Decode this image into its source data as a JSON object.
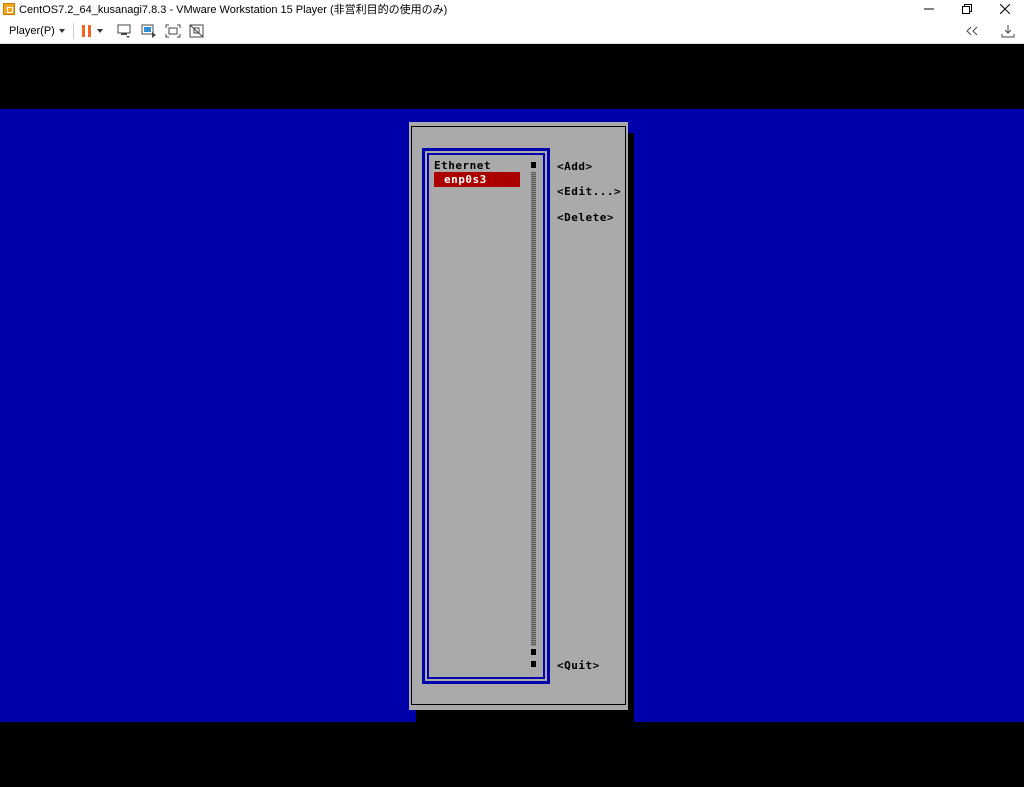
{
  "window": {
    "title": "CentOS7.2_64_kusanagi7.8.3 - VMware Workstation 15 Player (非営利目的の使用のみ)",
    "minimize_glyph": "—",
    "maximize_glyph": "❐",
    "close_glyph": "✕"
  },
  "toolbar": {
    "player_menu_label": "Player(P)",
    "pause_color": "#f26522"
  },
  "tui": {
    "list_category": "Ethernet",
    "selected_connection": "enp0s3",
    "buttons": {
      "add": "<Add>",
      "edit": "<Edit...>",
      "delete": "<Delete>",
      "quit": "<Quit>"
    },
    "colors": {
      "background": "#0000aa",
      "dialog": "#aaaaaa",
      "selection": "#aa0000"
    }
  }
}
